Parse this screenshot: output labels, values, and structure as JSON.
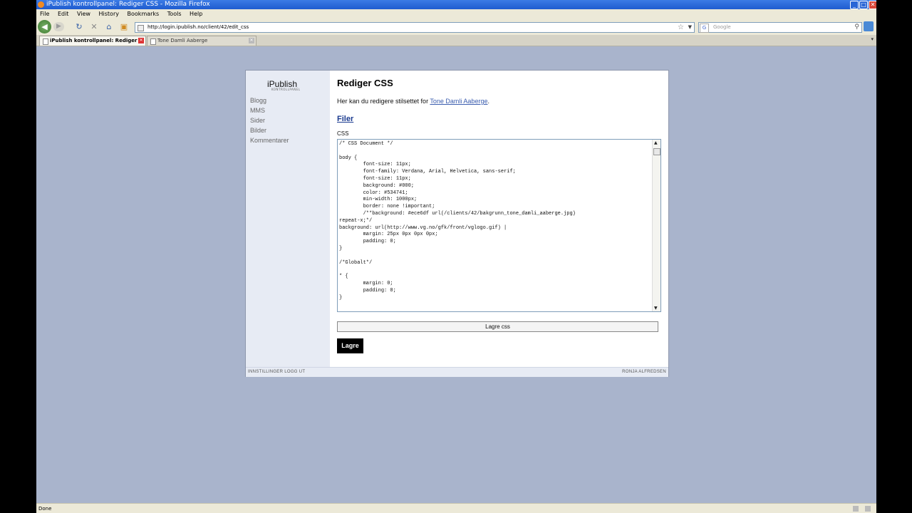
{
  "window": {
    "title": "iPublish kontrollpanel: Rediger CSS - Mozilla Firefox",
    "controls": [
      "_",
      "□",
      "✕"
    ]
  },
  "menubar": {
    "items": [
      "File",
      "Edit",
      "View",
      "History",
      "Bookmarks",
      "Tools",
      "Help"
    ]
  },
  "navbar": {
    "url": "http://login.ipublish.no/client/42/edit_css",
    "search_placeholder": "Google"
  },
  "tabs": [
    {
      "label": "iPublish kontrollpanel: Rediger CSS",
      "active": true
    },
    {
      "label": "Tone Damli Aaberge",
      "active": false
    }
  ],
  "sidebar": {
    "logo": "iPublish",
    "logo_sub": "KONTROLLPANEL",
    "items": [
      "Blogg",
      "MMS",
      "Sider",
      "Bilder",
      "Kommentarer"
    ]
  },
  "main": {
    "heading": "Rediger CSS",
    "intro_prefix": "Her kan du redigere stilsettet for ",
    "intro_link": "Tone Damli Aaberge",
    "intro_suffix": ".",
    "files_heading": "Filer",
    "css_label": "CSS",
    "css_code": "/* CSS Document */\n\nbody {\n\tfont-size: 11px;\n\tfont-family: Verdana, Arial, Helvetica, sans-serif;\n\tfont-size: 11px;\n\tbackground: #000;\n\tcolor: #534741;\n\tmin-width: 1000px;\n\tborder: none !important;\n\t/**background: #ece6df url(/clients/42/bakgrunn_tone_damli_aaberge.jpg)\nrepeat-x;*/\nbackground: url(http://www.vg.no/gfk/front/vglogo.gif) |\n\tmargin: 25px 0px 0px 0px;\n\tpadding: 0;\n}\n\n/*Globalt*/\n\n* {\n\tmargin: 0;\n\tpadding: 0;\n}\n\n",
    "save_css_label": "Lagre css",
    "save_label": "Lagre"
  },
  "footer": {
    "left": "INNSTILLINGER LOGG UT",
    "right": "RONJA ALFREDSEN"
  },
  "statusbar": {
    "text": "Done"
  },
  "colors": {
    "page_background": "#a9b4cc",
    "sidebar_background": "#e7ebf4",
    "link": "#3a5cae",
    "titlebar": "#1f5ccf"
  }
}
